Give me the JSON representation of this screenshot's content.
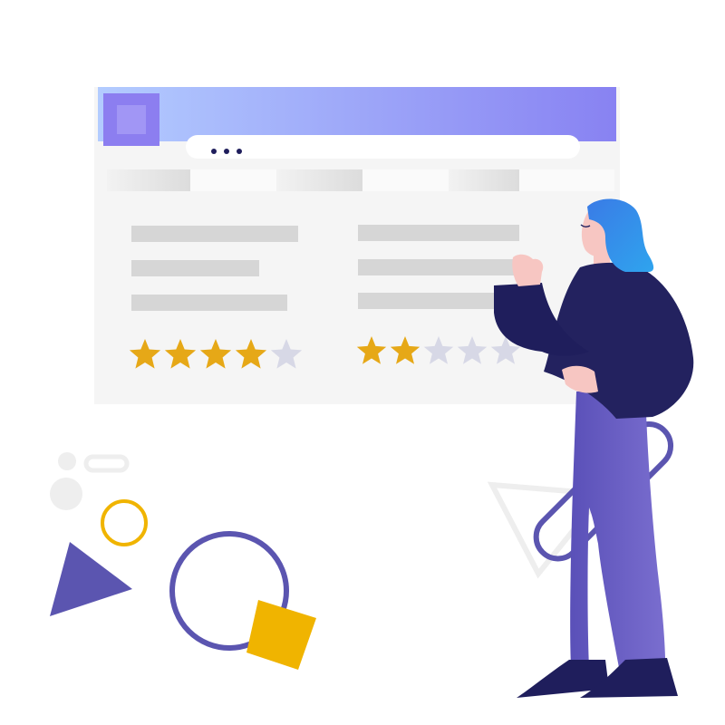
{
  "browser": {
    "address_bar": {
      "text": ""
    },
    "tabs": [
      {
        "label": ""
      },
      {
        "label": ""
      },
      {
        "label": ""
      }
    ]
  },
  "reviews": [
    {
      "rating": 4,
      "max_rating": 5
    },
    {
      "rating": 2,
      "max_rating": 5
    }
  ],
  "colors": {
    "header_start": "#b3ccff",
    "header_end": "#8882f2",
    "star_filled": "#e6a817",
    "star_empty": "#d7d8e6",
    "card_bg": "#f5f5f5",
    "skeleton": "#d6d6d6",
    "purple": "#5b55b0",
    "yellow": "#f0b400",
    "navy": "#1f1e5c",
    "pants": "#7467c4",
    "hair": "#2f86e8"
  }
}
